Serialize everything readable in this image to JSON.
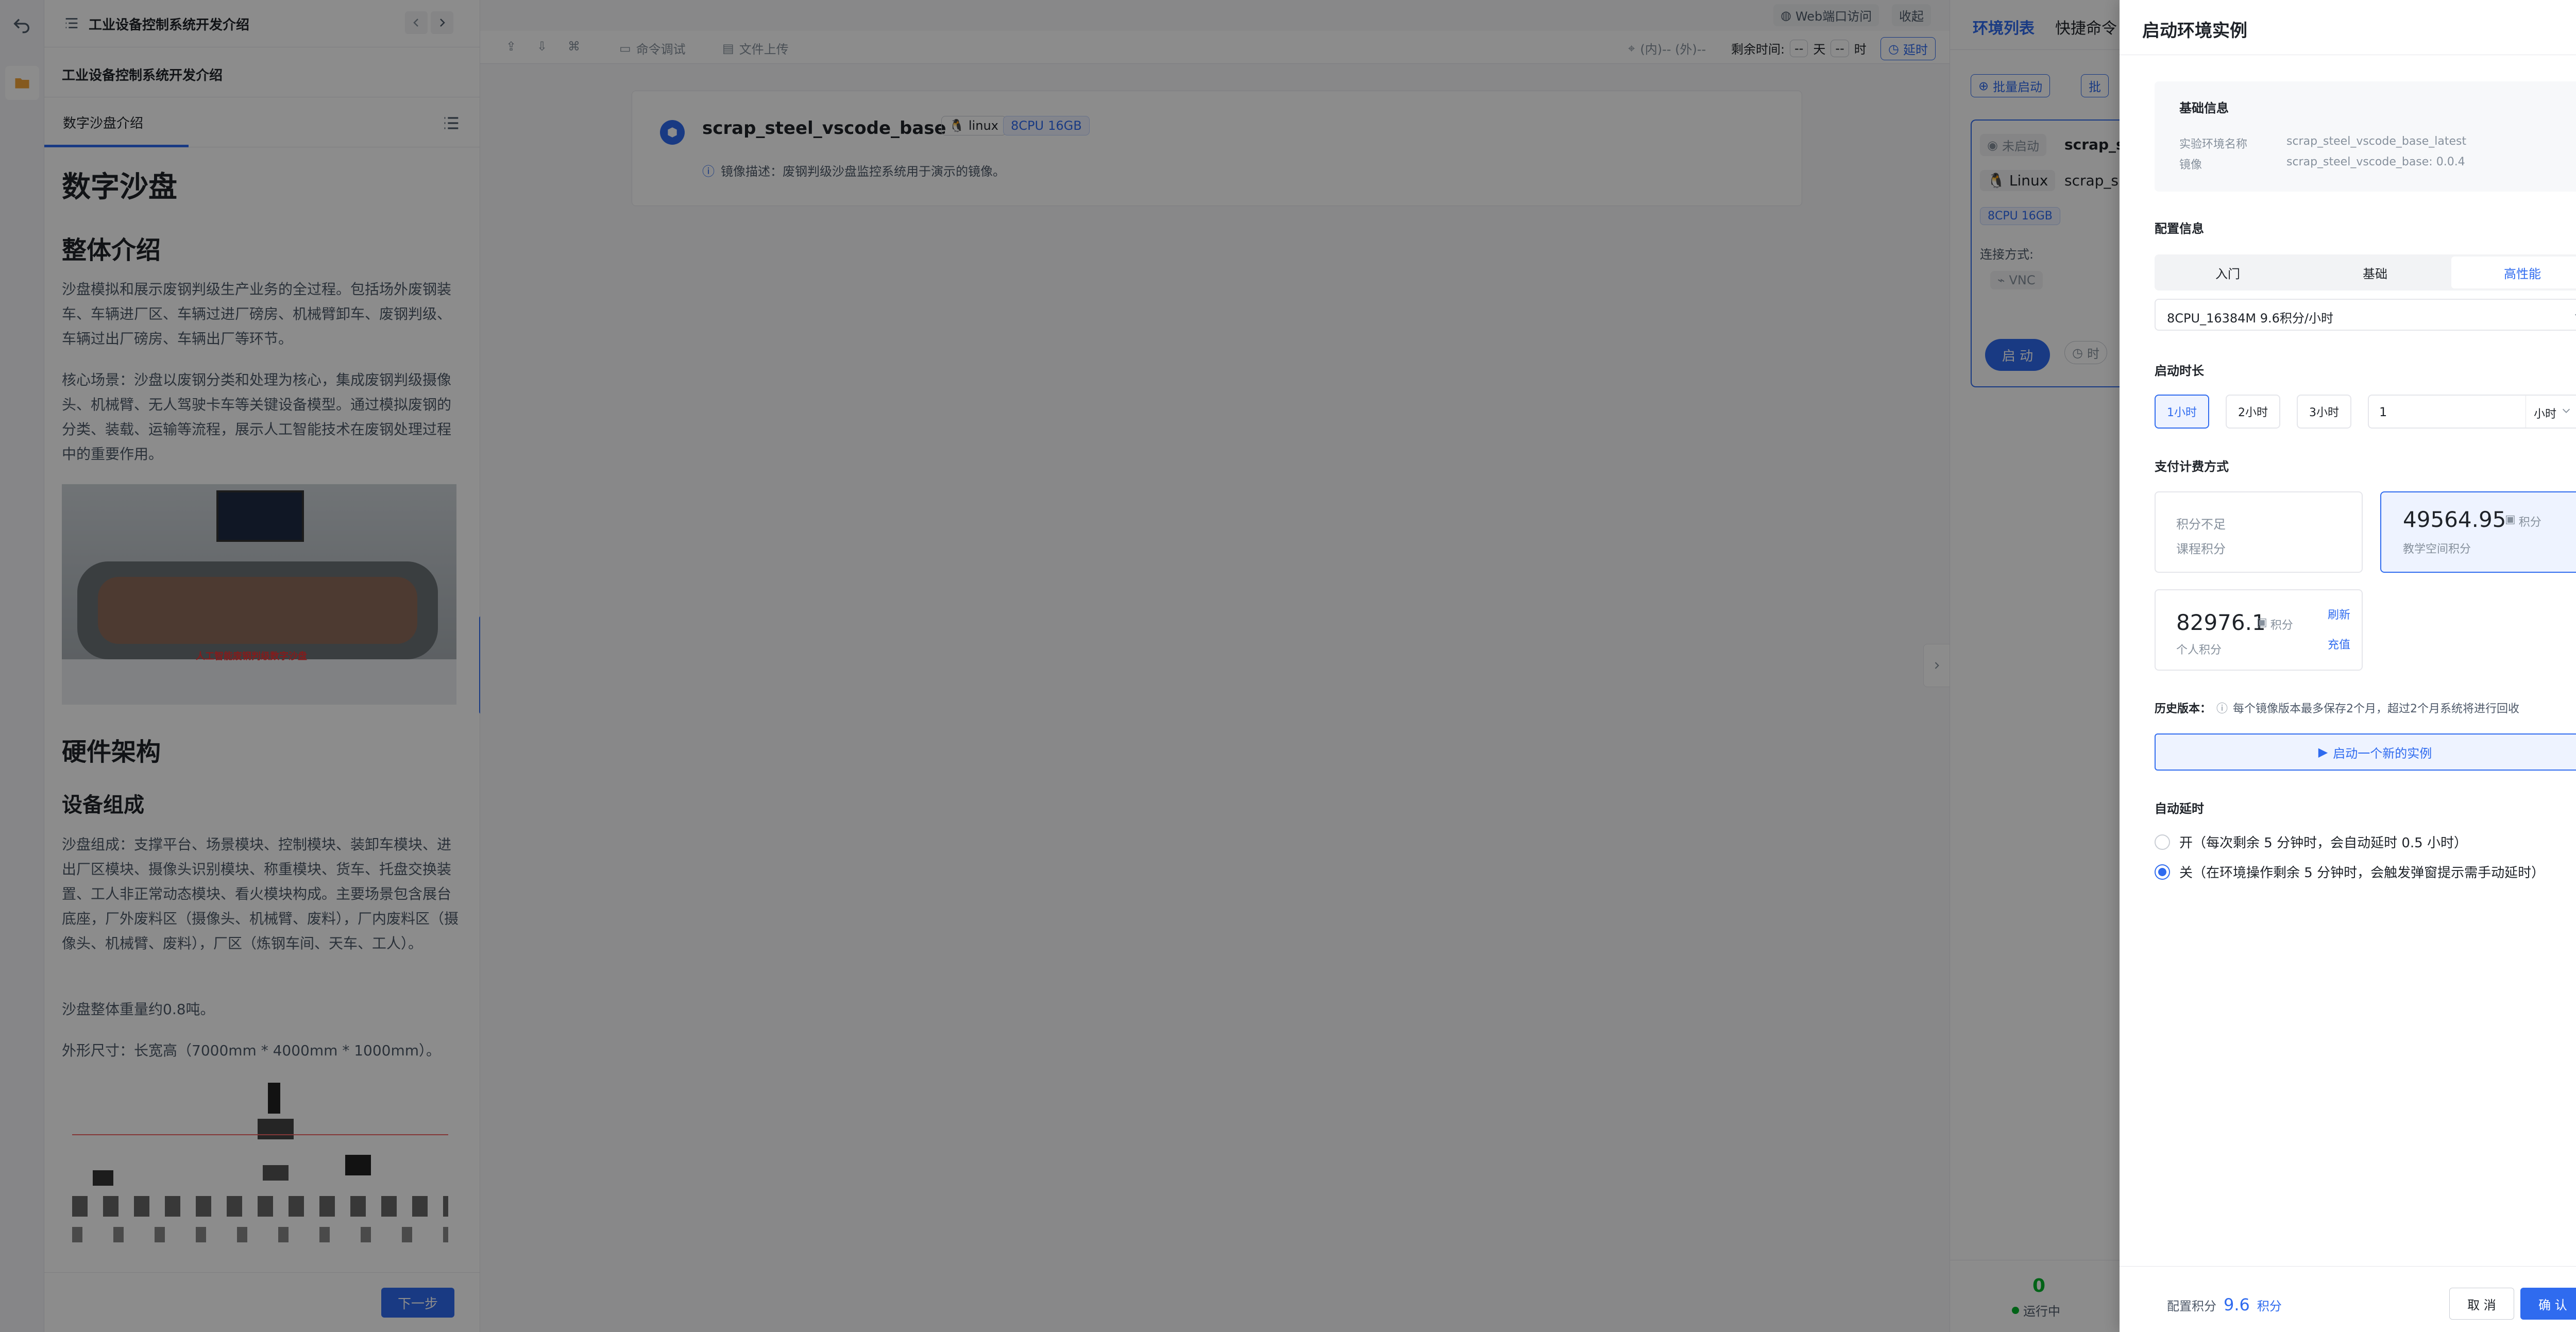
{
  "rail": {
    "back_icon": "undo-icon",
    "folder_icon": "folder-icon"
  },
  "doc": {
    "header_title": "工业设备控制系统开发介绍",
    "course_title": "工业设备控制系统开发介绍",
    "tab_label": "数字沙盘介绍",
    "h1": "数字沙盘",
    "h2_intro": "整体介绍",
    "p_intro": "沙盘模拟和展示废钢判级生产业务的全过程。包括场外废钢装车、车辆进厂区、车辆过进厂磅房、机械臂卸车、废钢判级、车辆过出厂磅房、车辆出厂等环节。",
    "p_core": "核心场景：沙盘以废钢分类和处理为核心，集成废钢判级摄像头、机械臂、无人驾驶卡车等关键设备模型。通过模拟废钢的分类、装载、运输等流程，展示人工智能技术在废钢处理过程中的重要作用。",
    "image_caption": "人工智能废钢判级数字沙盘",
    "h2_hw": "硬件架构",
    "h3_devices": "设备组成",
    "p_devices": "沙盘组成：支撑平台、场景模块、控制模块、装卸车模块、进出厂区模块、摄像头识别模块、称重模块、货车、托盘交换装置、工人非正常动态模块、看火模块构成。主要场景包含展台底座，厂外废料区（摄像头、机械臂、废料），厂内废料区（摄像头、机械臂、废料），厂区（炼钢车间、天车、工人）。",
    "p_weight": "沙盘整体重量约0.8吨。",
    "p_size": "外形尺寸：长宽高（7000mm * 4000mm * 1000mm）。",
    "next_button": "下一步"
  },
  "toolbar": {
    "cmd_debug": "命令调试",
    "file_upload": "文件上传",
    "coords": "(内)-- (外)--",
    "remaining_label": "剩余时间:",
    "day_val": "--",
    "day_unit": "天",
    "hour_val": "--",
    "hour_unit": "时",
    "extend": "延时",
    "web_port": "Web端口访问",
    "collapse": "收起"
  },
  "env_card": {
    "name": "scrap_steel_vscode_base",
    "os_tag": "linux",
    "cpu_tag": "8CPU",
    "mem_tag": "16GB",
    "desc": "镜像描述：废钢判级沙盘监控系统用于演示的镜像。"
  },
  "rlist": {
    "tab_env": "环境列表",
    "tab_quick": "快捷命令",
    "batch_start": "批量启动",
    "batch_more": "批",
    "status_not_started": "未启动",
    "item_name": "scrap_s",
    "os": "Linux",
    "item_name2": "scrap_s",
    "cpu_mem": "8CPU 16GB",
    "connect_label": "连接方式:",
    "vnc": "VNC",
    "start": "启 动",
    "time": "时",
    "running_count": "0",
    "running_label": "运行中"
  },
  "drawer": {
    "title": "启动环境实例",
    "basic_title": "基础信息",
    "basic_name_label": "实验环境名称",
    "basic_name_value": "scrap_steel_vscode_base_latest",
    "basic_image_label": "镜像",
    "basic_image_value": "scrap_steel_vscode_base: 0.0.4",
    "config_title": "配置信息",
    "tiers": [
      "入门",
      "基础",
      "高性能"
    ],
    "tier_selected": "高性能",
    "spec_value": "8CPU_16384M   9.6积分/小时",
    "duration_title": "启动时长",
    "durations": [
      "1小时",
      "2小时",
      "3小时"
    ],
    "duration_input": "1",
    "duration_unit": "小时",
    "pay_title": "支付计费方式",
    "pay_insufficient": "积分不足",
    "pay_course": "课程积分",
    "pay_teach_amount": "49564.95",
    "pay_points_unit": "积分",
    "pay_teach_label": "教学空间积分",
    "pay_personal_amount": "82976.1",
    "pay_personal_label": "个人积分",
    "refresh": "刷新",
    "recharge": "充值",
    "history_label": "历史版本：",
    "history_note": "每个镜像版本最多保存2个月，超过2个月系统将进行回收",
    "new_instance": "启动一个新的实例",
    "auto_title": "自动延时",
    "auto_on": "开（每次剩余 5 分钟时，会自动延时 0.5 小时）",
    "auto_off": "关（在环境操作剩余 5 分钟时，会触发弹窗提示需手动延时）",
    "footer_label": "配置积分",
    "footer_points": "9.6",
    "footer_unit": "积分",
    "cancel": "取 消",
    "confirm": "确 认"
  },
  "colors": {
    "accent": "#2f6bef",
    "overlay": "rgba(0,0,0,0.45)",
    "running": "#00b42a"
  }
}
